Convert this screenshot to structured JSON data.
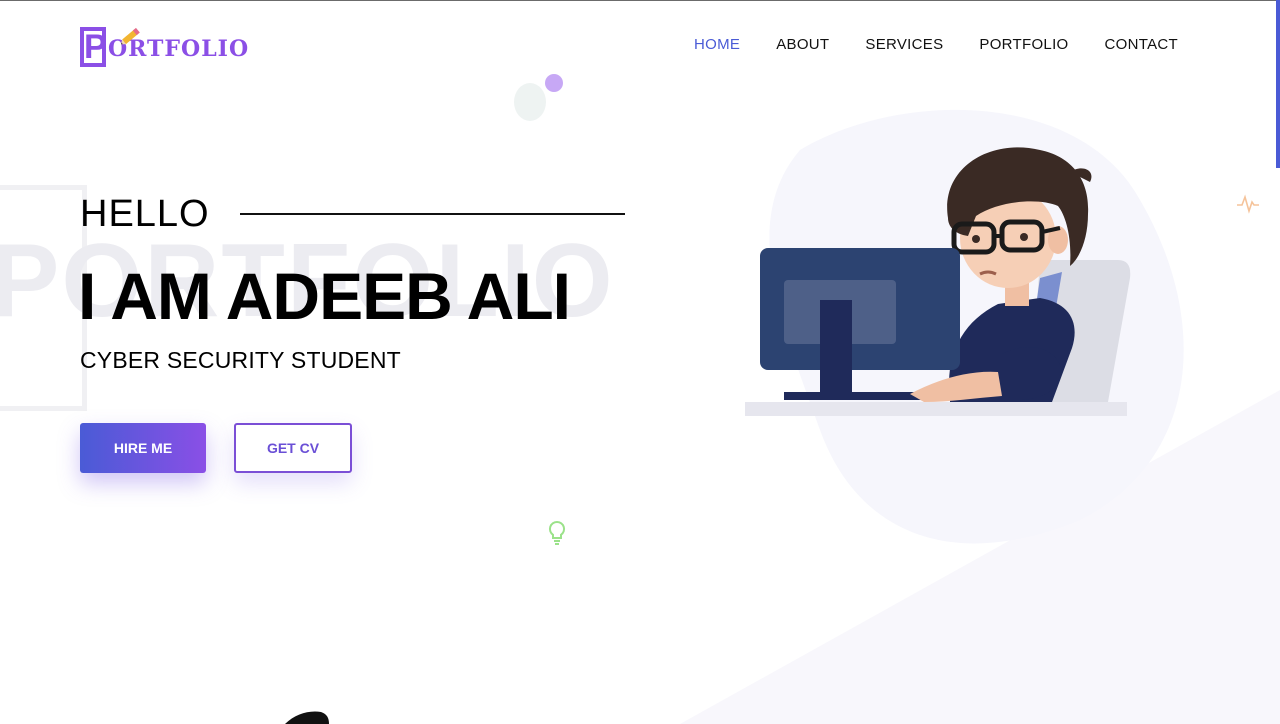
{
  "brand": {
    "logo_text": "ORTFOLIO",
    "logo_initial": "P"
  },
  "nav": {
    "items": [
      {
        "label": "HOME",
        "active": true
      },
      {
        "label": "ABOUT",
        "active": false
      },
      {
        "label": "SERVICES",
        "active": false
      },
      {
        "label": "PORTFOLIO",
        "active": false
      },
      {
        "label": "CONTACT",
        "active": false
      }
    ]
  },
  "hero": {
    "watermark": "PORTFOLIO",
    "greeting": "HELLO",
    "name": "I AM ADEEB ALI",
    "role": "CYBER SECURITY STUDENT",
    "hire_label": "HIRE ME",
    "cv_label": "GET CV"
  },
  "colors": {
    "accent": "#4a5bd6",
    "brand": "#8b4fe6",
    "text": "#111111"
  },
  "icons": [
    "pencil-icon",
    "lightbulb-icon",
    "pulse-icon"
  ]
}
